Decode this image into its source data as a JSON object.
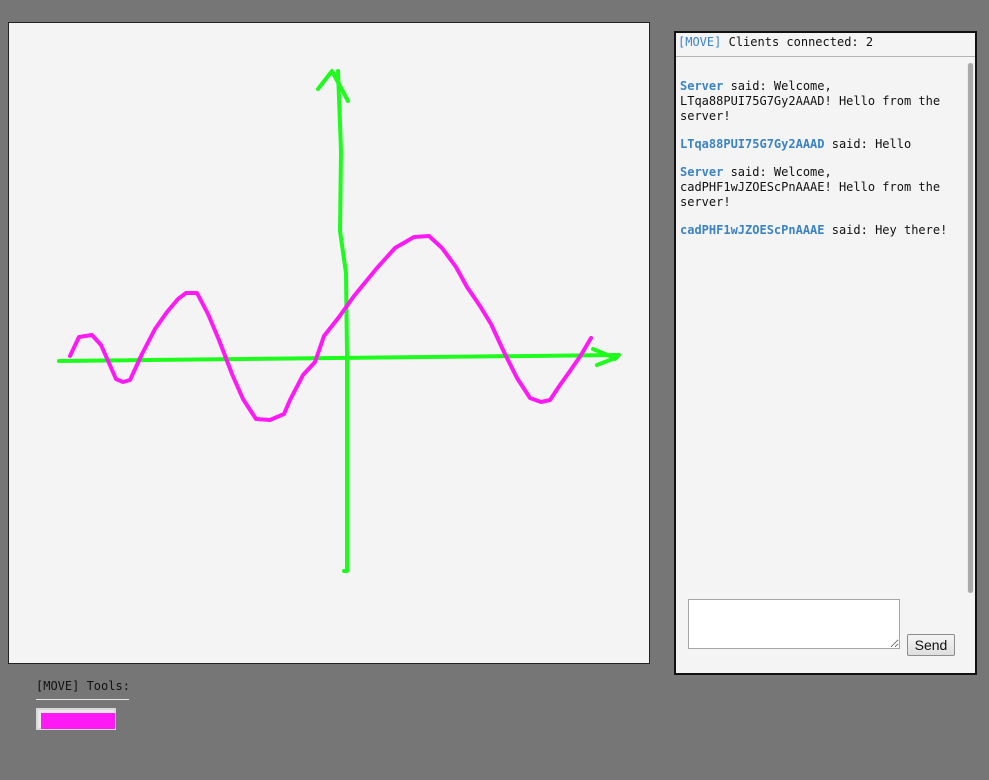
{
  "canvas": {
    "background": "#f4f4f4",
    "strokes": [
      {
        "name": "axes",
        "color": "#1dfc1d",
        "semantic": "x-axis-and-y-axis-drawing"
      },
      {
        "name": "curve",
        "color": "#ff19f5",
        "semantic": "sine-like-wave-drawing"
      }
    ]
  },
  "chat": {
    "mode_label": "[MOVE]",
    "clients_text": "Clients connected: 2",
    "messages": [
      {
        "sender": "Server",
        "text": " said: Welcome, LTqa88PUI75G7Gy2AAAD! Hello from the server!"
      },
      {
        "sender": "LTqa88PUI75G7Gy2AAAD",
        "text": " said: Hello"
      },
      {
        "sender": "Server",
        "text": " said: Welcome, cadPHF1wJZOEScPnAAAE! Hello from the server!"
      },
      {
        "sender": "cadPHF1wJZOEScPnAAAE",
        "text": " said: Hey there!"
      }
    ],
    "input_value": "",
    "send_label": "Send"
  },
  "tools": {
    "title": "[MOVE] Tools:",
    "selected_color": "#ff19f5"
  },
  "colors": {
    "page_background": "#767676",
    "link": "#3b83c4",
    "axes": "#1dfc1d",
    "curve": "#ff19f5"
  },
  "icons": {
    "textarea_resize": "resize-grip-icon"
  }
}
